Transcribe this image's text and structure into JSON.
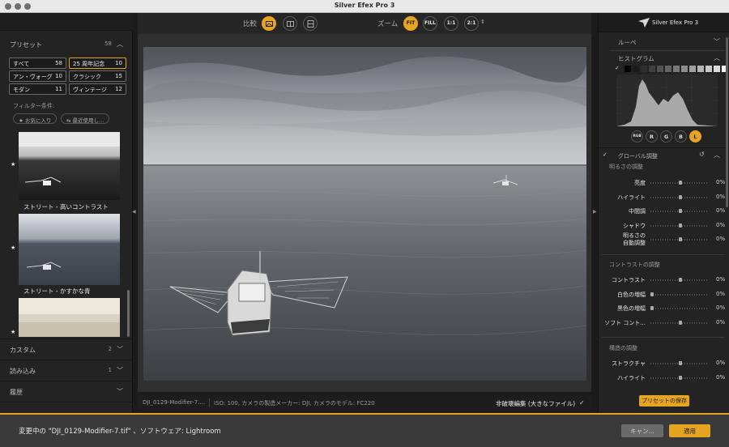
{
  "window": {
    "title": "Silver Efex Pro 3"
  },
  "presets": {
    "header": "プリセット",
    "count": "58",
    "chips": [
      {
        "label": "すべて",
        "count": "58"
      },
      {
        "label": "25 周年記念",
        "count": "10"
      },
      {
        "label": "アン・ヴォーグ",
        "count": "10"
      },
      {
        "label": "クラシック",
        "count": "15"
      },
      {
        "label": "モダン",
        "count": "11"
      },
      {
        "label": "ヴィンテージ",
        "count": "12"
      }
    ],
    "filter_label": "フィルター条件:",
    "filters": [
      "★ お気に入り",
      "⇆ 最近使用し..."
    ],
    "thumbs": [
      {
        "label": "ストリート - 高いコントラスト"
      },
      {
        "label": "ストリート - かすかな青"
      },
      {
        "label": ""
      }
    ]
  },
  "left_sections": [
    {
      "label": "カスタム",
      "count": "2"
    },
    {
      "label": "読み込み",
      "count": "1"
    },
    {
      "label": "履歴",
      "count": ""
    }
  ],
  "toolbar": {
    "compare_label": "比較",
    "zoom_label": "ズーム",
    "zoom_buttons": [
      "FIT",
      "FILL",
      "1:1",
      "2:1"
    ]
  },
  "info": {
    "filename": "DJI_0129-Modifier-7....",
    "meta": "ISO: 100, カメラの製造メーカー: DJI, カメラのモデル: FC220",
    "nondestructive": "非破壊編集 (大きなファイル)"
  },
  "right": {
    "brand": "Silver Efex Pro 3",
    "loupe": "ルーペ",
    "histogram": "ヒストグラム",
    "swatches": [
      "#050505",
      "#1c1c1c",
      "#2e2e2e",
      "#404040",
      "#525252",
      "#646464",
      "#787878",
      "#8c8c8c",
      "#a0a0a0",
      "#b4b4b4",
      "#c8c8c8",
      "#dcdcdc",
      "#f2f2f2"
    ],
    "channels": [
      "RGB",
      "R",
      "G",
      "B",
      "L"
    ],
    "global": "グローバル調整",
    "brightness_group": "明るさの調整",
    "brightness": [
      {
        "label": "亮度",
        "value": "0%",
        "pos": 0.5
      },
      {
        "label": "ハイライト",
        "value": "0%",
        "pos": 0.5
      },
      {
        "label": "中間調",
        "value": "0%",
        "pos": 0.5
      },
      {
        "label": "シャドウ",
        "value": "0%",
        "pos": 0.5
      },
      {
        "label": "明るさの自動調整",
        "label1": "明るさの",
        "label2": "自動調整",
        "value": "0%",
        "pos": 0.5
      }
    ],
    "contrast_group": "コントラストの調整",
    "contrast": [
      {
        "label": "コントラスト",
        "value": "0%",
        "pos": 0.5
      },
      {
        "label": "白色の増幅",
        "value": "0%",
        "pos": 0.0
      },
      {
        "label": "黒色の増幅",
        "value": "0%",
        "pos": 0.0
      },
      {
        "label": "ソフト コント...",
        "value": "0%",
        "pos": 0.5
      }
    ],
    "structure_group": "構造の調整",
    "structure": [
      {
        "label": "ストラクチャ",
        "value": "0%",
        "pos": 0.5
      },
      {
        "label": "ハイライト",
        "value": "0%",
        "pos": 0.5
      }
    ],
    "save_preset": "プリセットの保存"
  },
  "footer": {
    "message": "変更中の \"DJI_0129-Modifier-7.tif\" 、ソフトウェア: Lightroom",
    "cancel": "キャン...",
    "apply": "適用"
  },
  "colors": {
    "accent": "#e6a423",
    "panel": "#232323",
    "canvas": "#2f2f2f"
  }
}
